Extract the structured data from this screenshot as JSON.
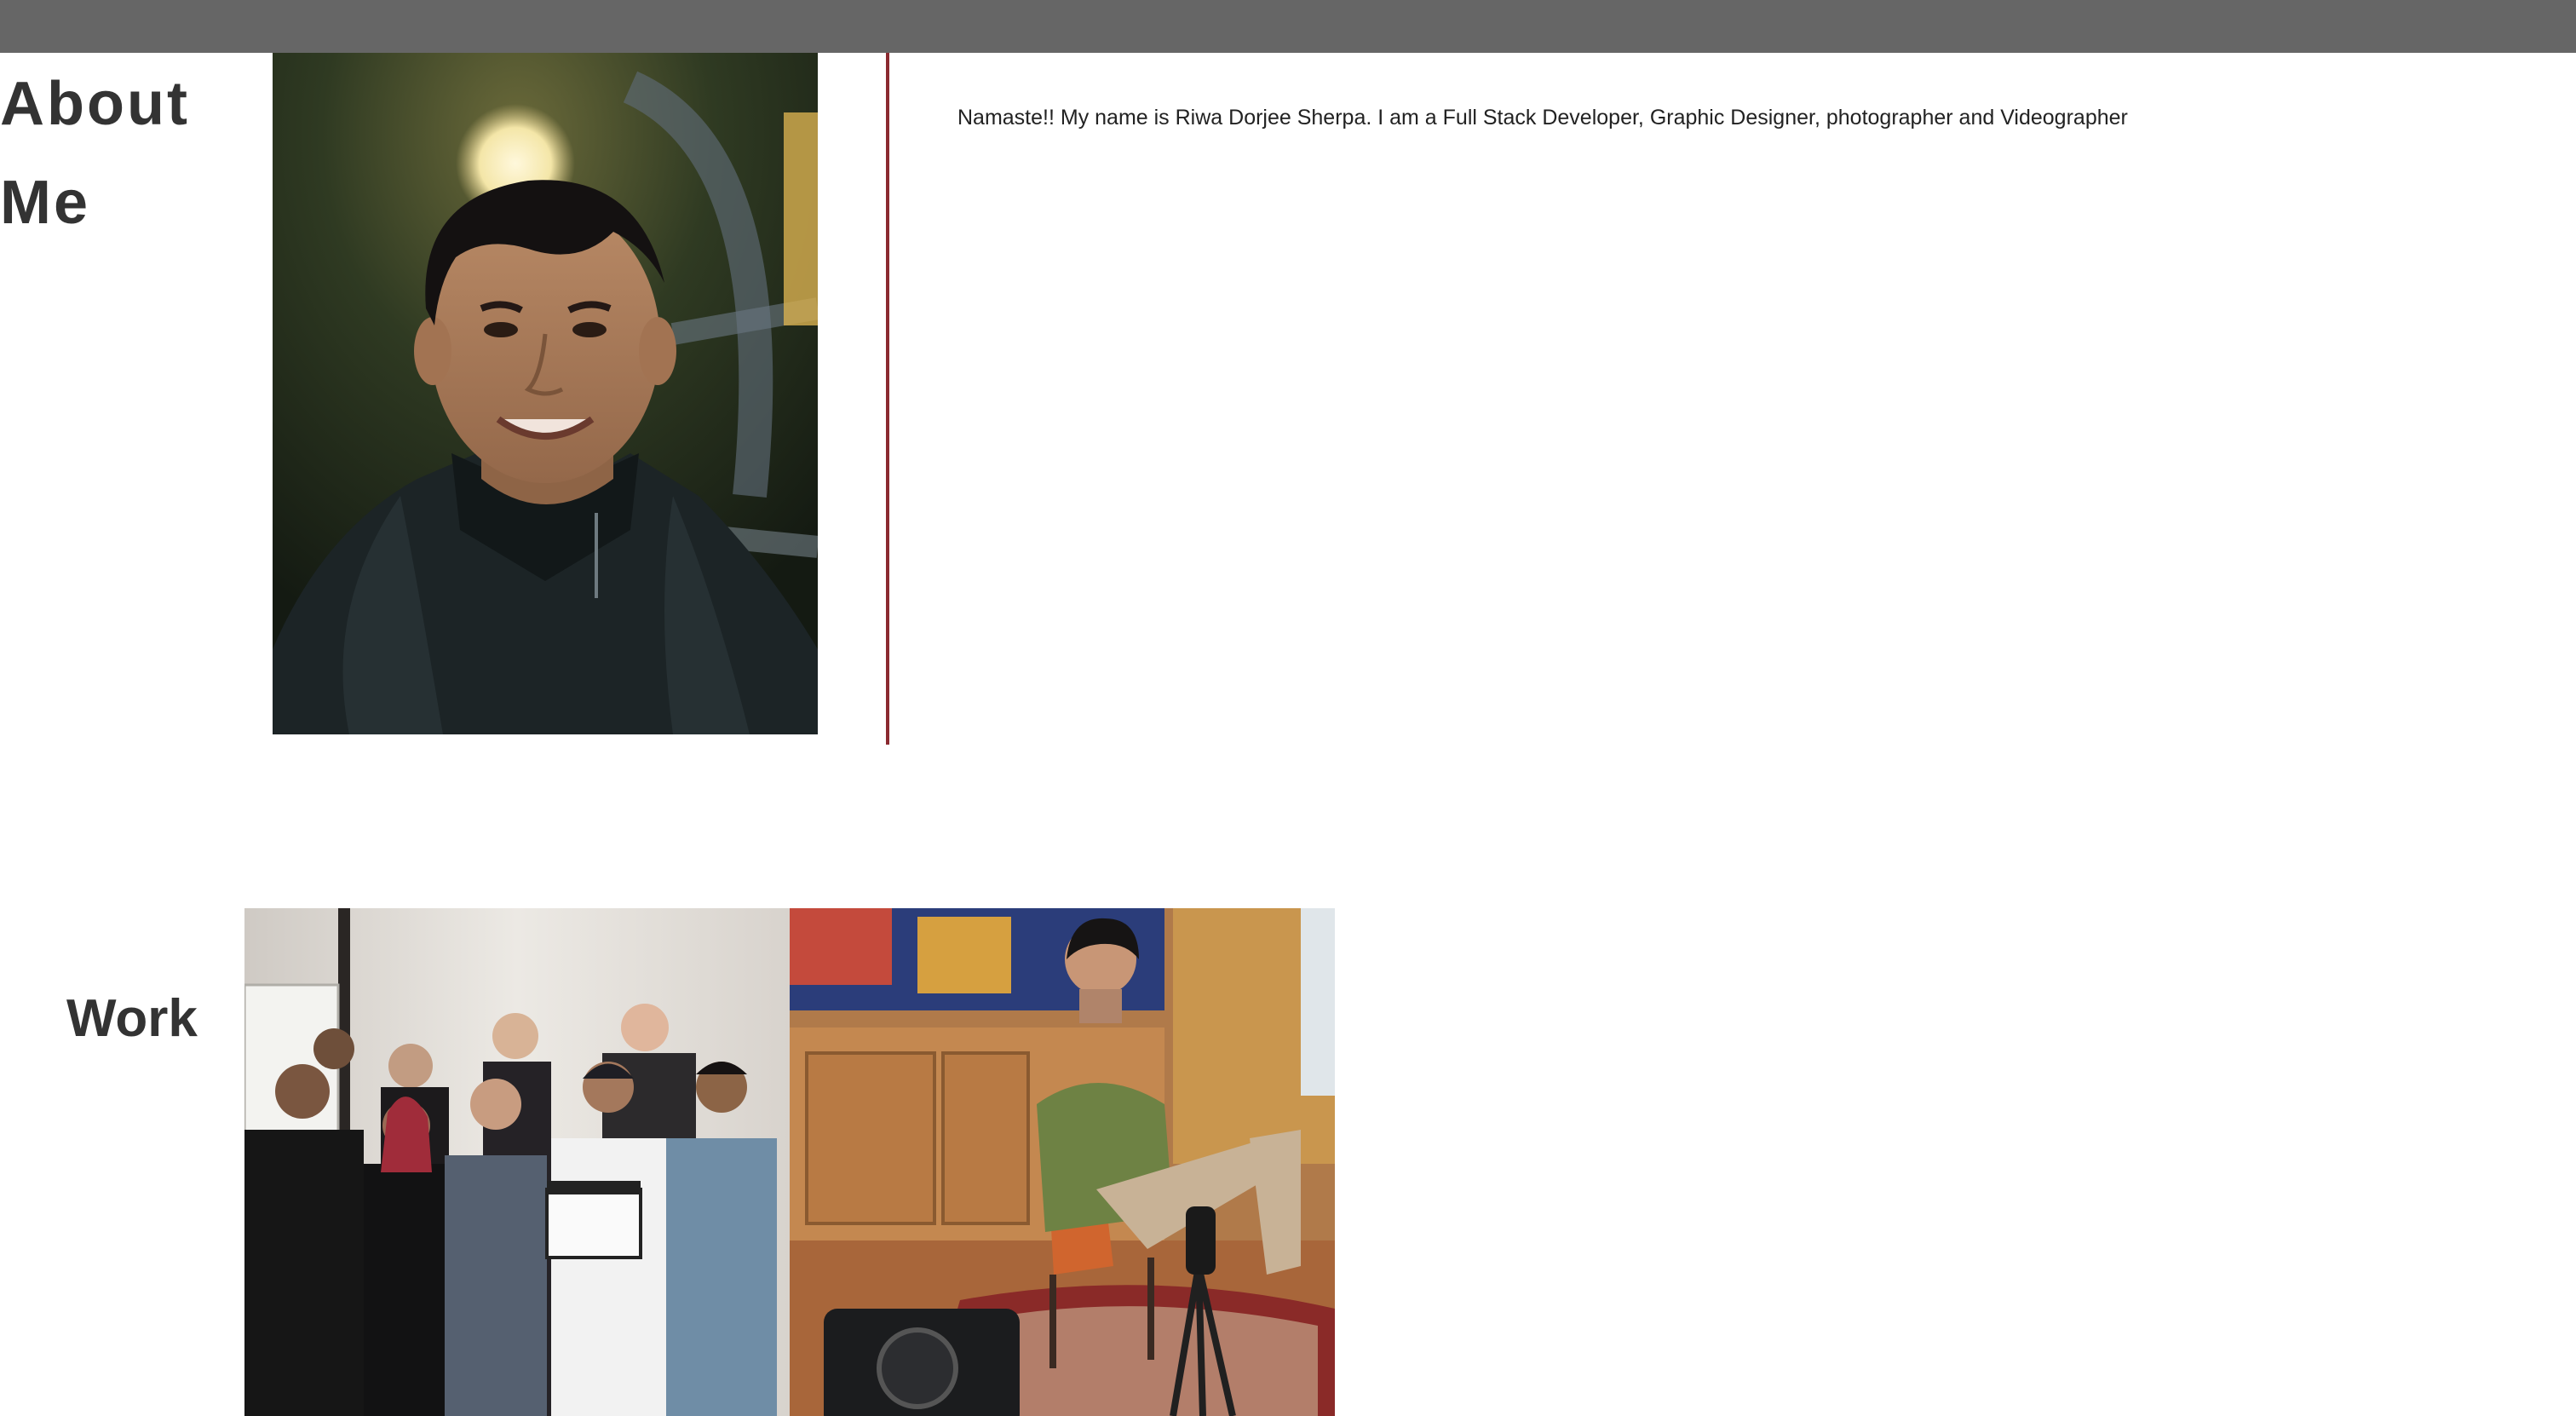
{
  "about": {
    "heading": "About Me",
    "portrait_alt": "Portrait of Riwa Dorjee Sherpa smiling outdoors at night",
    "intro": "Namaste!! My name is Riwa Dorjee Sherpa. I am a Full Stack Developer, Graphic Designer, photographer and Videographer"
  },
  "work": {
    "heading": "Work",
    "photos": [
      {
        "alt": "Film crew group photo holding a clapperboard"
      },
      {
        "alt": "Man seated in front of a camera during an interview shoot"
      }
    ]
  },
  "colors": {
    "topbar": "#666666",
    "divider": "#8b2a30",
    "heading_text": "#333333"
  }
}
